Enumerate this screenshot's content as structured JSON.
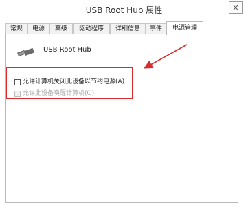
{
  "window": {
    "title": "USB Root Hub 属性",
    "close_glyph": "×"
  },
  "tabs": [
    {
      "label": "常规"
    },
    {
      "label": "电源"
    },
    {
      "label": "高级"
    },
    {
      "label": "驱动程序"
    },
    {
      "label": "详细信息"
    },
    {
      "label": "事件"
    },
    {
      "label": "电源管理"
    }
  ],
  "active_tab": "电源管理",
  "device": {
    "icon": "usb-connector-icon",
    "name": "USB Root Hub"
  },
  "options": [
    {
      "label": "允许计算机关闭此设备以节约电源(A)",
      "checked": false,
      "enabled": true
    },
    {
      "label": "允许此设备唤醒计算机(O)",
      "checked": false,
      "enabled": false
    }
  ],
  "annotation": {
    "color": "#d92d2d",
    "icon": "red-arrow-icon"
  }
}
